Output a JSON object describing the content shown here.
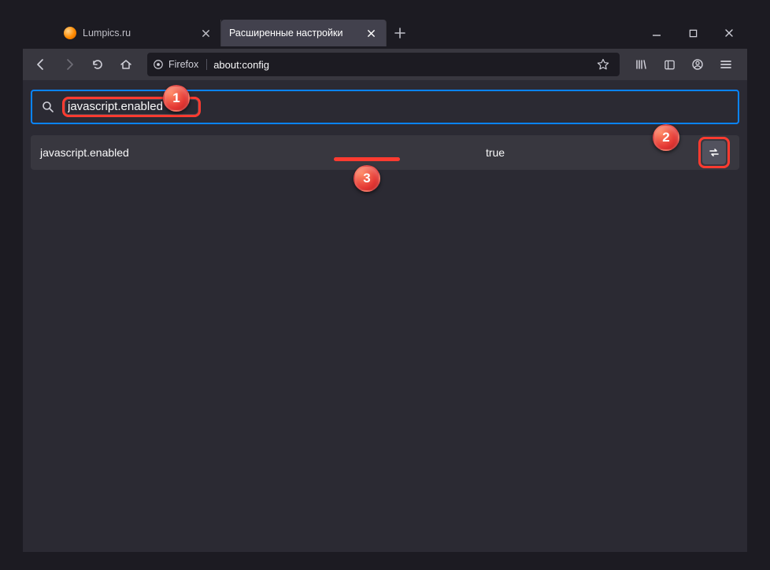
{
  "tabs": [
    {
      "title": "Lumpics.ru",
      "active": false,
      "favicon": "orange"
    },
    {
      "title": "Расширенные настройки",
      "active": true,
      "favicon": "none"
    }
  ],
  "urlbar": {
    "identity_label": "Firefox",
    "url": "about:config"
  },
  "search": {
    "value": "javascript.enabled"
  },
  "pref": {
    "name": "javascript.enabled",
    "value": "true"
  },
  "annotations": {
    "ball1": "1",
    "ball2": "2",
    "ball3": "3"
  }
}
